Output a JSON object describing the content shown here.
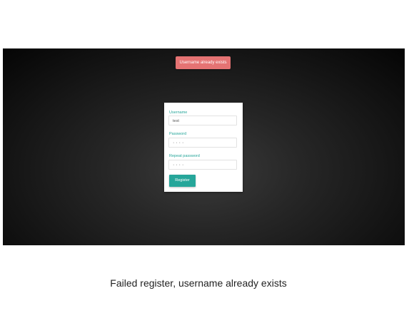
{
  "alert": {
    "message": "Username already exists",
    "color": "#e57373"
  },
  "form": {
    "username": {
      "label": "Username",
      "value": "test"
    },
    "password": {
      "label": "Password",
      "value": "····"
    },
    "repeat_password": {
      "label": "Repeat password",
      "value": "····"
    },
    "register_label": "Register",
    "accent_color": "#26a69a"
  },
  "caption": "Failed register, username already exists"
}
